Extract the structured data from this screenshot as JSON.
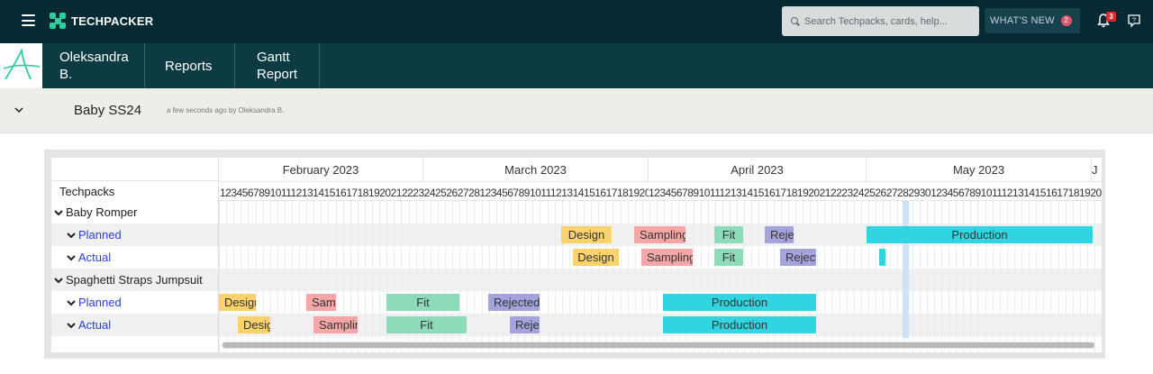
{
  "topbar": {
    "brand": "TECHPACKER",
    "search_placeholder": "Search Techpacks, cards, help...",
    "whats_new": "WHAT'S NEW",
    "whats_new_count": "2",
    "notifications_count": "3",
    "icons": [
      "menu-icon",
      "search-icon",
      "bell-icon",
      "help-chat-icon"
    ]
  },
  "nav": {
    "user": "Oleksandra B.",
    "reports": "Reports",
    "gantt": "Gantt Report"
  },
  "techpack": {
    "title": "Baby SS24",
    "meta": "a few seconds ago by Oleksandra B."
  },
  "gantt": {
    "column_header": "Techpacks",
    "months": [
      "February 2023",
      "March 2023",
      "April 2023",
      "May 2023",
      "J"
    ],
    "day_rows": [
      "1234567891011121314151617181920212223242526272812345678910111213141516171819202122232425262728293031",
      "123456789101112131415161718192021222324252627282930123456789101112131415161718192021222324252627282930311"
    ],
    "rows": [
      {
        "label": "Baby Romper",
        "kind": "group"
      },
      {
        "label": "Planned",
        "kind": "sub"
      },
      {
        "label": "Actual",
        "kind": "sub"
      },
      {
        "label": "Spaghetti Straps Jumpsuit",
        "kind": "group"
      },
      {
        "label": "Planned",
        "kind": "sub"
      },
      {
        "label": "Actual",
        "kind": "sub"
      }
    ],
    "bars": {
      "design": "Design",
      "sampling": "Sampling",
      "fit": "Fit",
      "rejected": "Rejected",
      "production": "Production"
    },
    "colors": {
      "design": "#fbd26b",
      "sampling": "#f4a7a6",
      "fit": "#8ddbb8",
      "rejected": "#a4a4dc",
      "production": "#31d5e2"
    }
  }
}
